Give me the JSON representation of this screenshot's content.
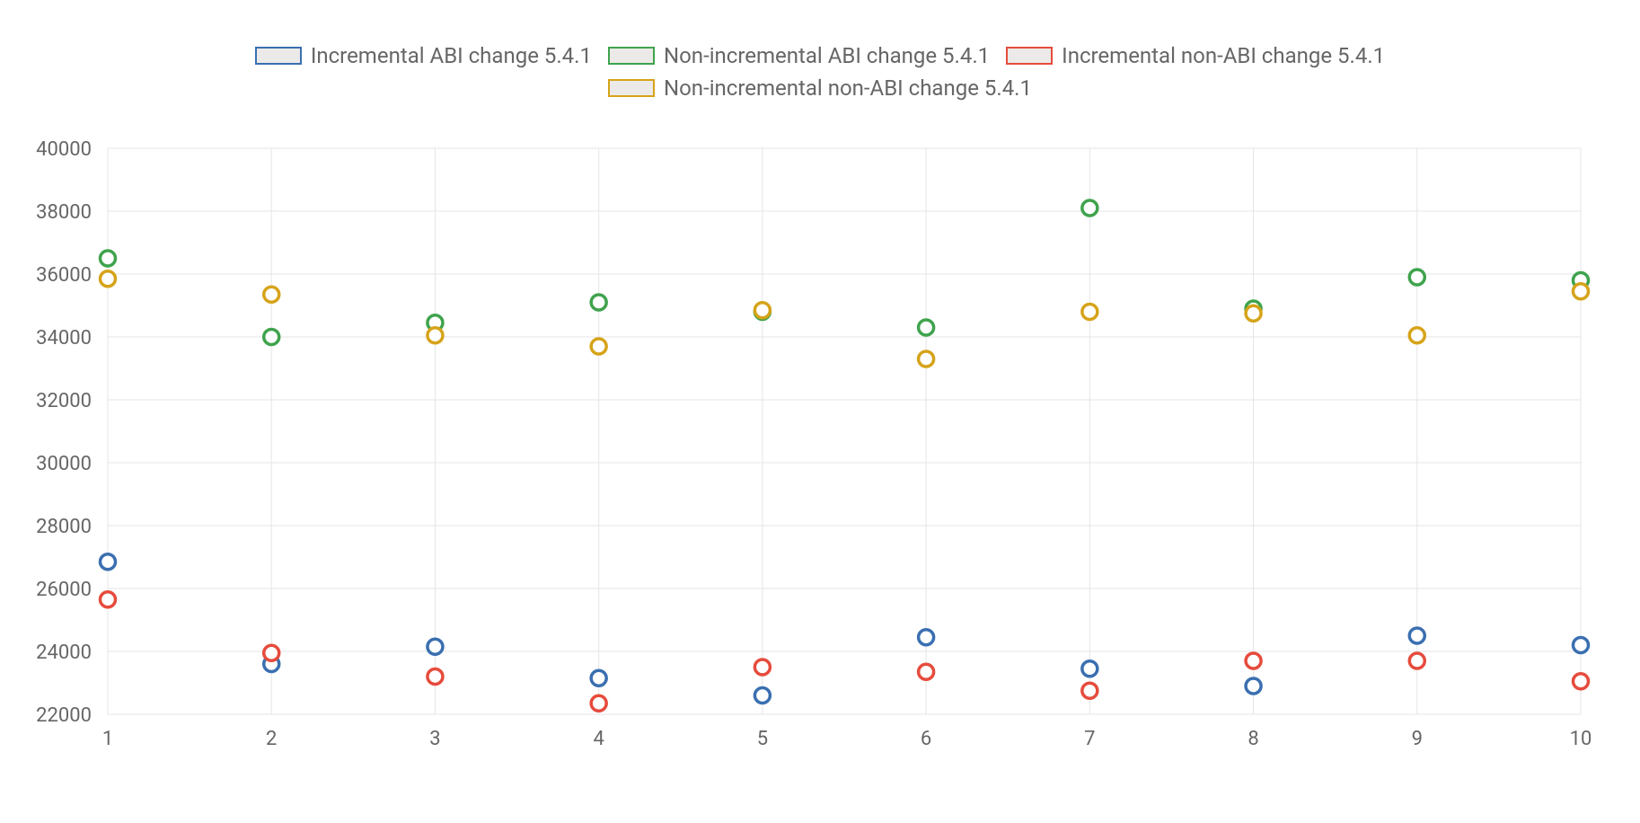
{
  "chart_data": {
    "type": "scatter",
    "x": [
      1,
      2,
      3,
      4,
      5,
      6,
      7,
      8,
      9,
      10
    ],
    "xlabel": "",
    "ylabel": "",
    "title": "",
    "xlim": [
      1,
      10
    ],
    "ylim": [
      22000,
      40000
    ],
    "y_ticks": [
      22000,
      24000,
      26000,
      28000,
      30000,
      32000,
      34000,
      36000,
      38000,
      40000
    ],
    "x_ticks": [
      1,
      2,
      3,
      4,
      5,
      6,
      7,
      8,
      9,
      10
    ],
    "grid": true,
    "legend_position": "top-center",
    "series": [
      {
        "name": "Incremental ABI change 5.4.1",
        "color": "#3a6fb0",
        "values": [
          26850,
          23600,
          24150,
          23150,
          22600,
          24450,
          23450,
          22900,
          24500,
          24200
        ]
      },
      {
        "name": "Non-incremental ABI change 5.4.1",
        "color": "#3fa34d",
        "values": [
          36500,
          34000,
          34450,
          35100,
          34800,
          34300,
          38100,
          34900,
          35900,
          35800
        ]
      },
      {
        "name": "Incremental non-ABI change 5.4.1",
        "color": "#e64b3c",
        "values": [
          25650,
          23950,
          23200,
          22350,
          23500,
          23350,
          22750,
          23700,
          23700,
          23050
        ]
      },
      {
        "name": "Non-incremental non-ABI change 5.4.1",
        "color": "#d6a319",
        "values": [
          35850,
          35350,
          34050,
          33700,
          34850,
          33300,
          34800,
          34750,
          34050,
          35450
        ]
      }
    ]
  }
}
